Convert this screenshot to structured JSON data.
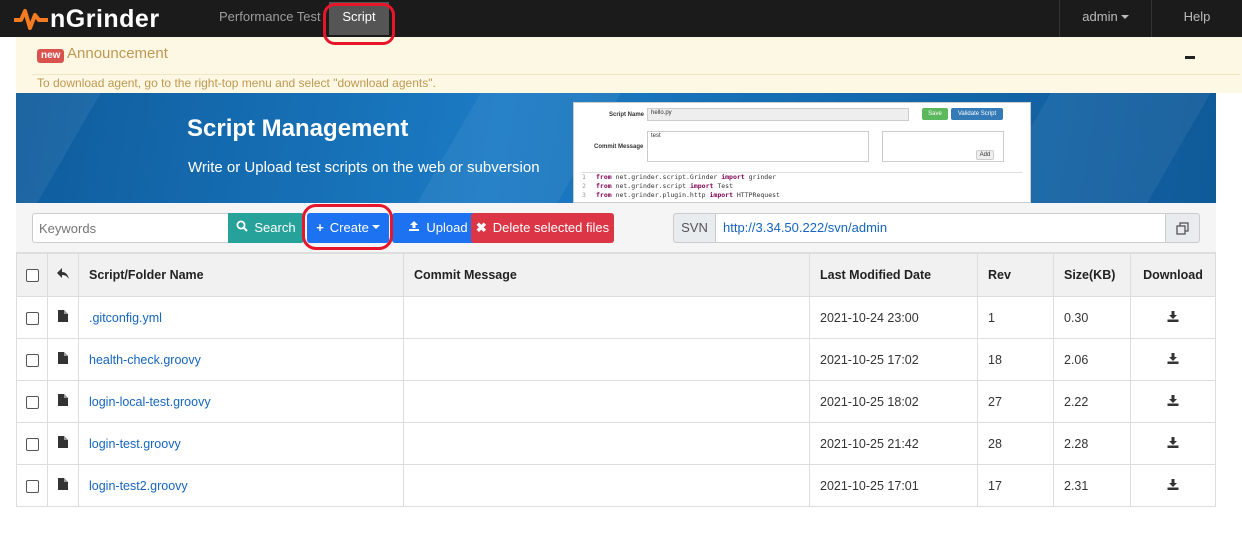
{
  "navbar": {
    "brand": "nGrinder",
    "items": [
      {
        "label": "Performance Test"
      },
      {
        "label": "Script",
        "active": true
      }
    ],
    "user": "admin",
    "help": "Help"
  },
  "announcement": {
    "badge": "new",
    "title": "Announcement",
    "text": "To download agent, go to the right-top menu and select \"download agents\"."
  },
  "banner": {
    "title": "Script Management",
    "subtitle": "Write or Upload test scripts on the web or subversion",
    "preview": {
      "script_name_label": "Script Name",
      "script_name_value": "hello.py",
      "save": "Save",
      "validate": "Validate Script",
      "commit_label": "Commit Message",
      "commit_value": "test",
      "add": "Add",
      "code": [
        {
          "ln": "1",
          "kw1": "from",
          "mod": " net.grinder.script.Grinder ",
          "kw2": "import",
          "name": " grinder"
        },
        {
          "ln": "2",
          "kw1": "from",
          "mod": " net.grinder.script ",
          "kw2": "import",
          "name": " Test"
        },
        {
          "ln": "3",
          "kw1": "from",
          "mod": " net.grinder.plugin.http ",
          "kw2": "import",
          "name": " HTTPRequest"
        }
      ]
    }
  },
  "toolbar": {
    "search_placeholder": "Keywords",
    "search": "Search",
    "create": "Create",
    "upload": "Upload",
    "delete": "Delete selected files",
    "svn_label": "SVN",
    "svn_url": "http://3.34.50.222/svn/admin"
  },
  "table": {
    "headers": {
      "name": "Script/Folder Name",
      "message": "Commit Message",
      "date": "Last Modified Date",
      "rev": "Rev",
      "size": "Size(KB)",
      "download": "Download"
    },
    "rows": [
      {
        "name": ".gitconfig.yml",
        "message": "",
        "date": "2021-10-24 23:00",
        "rev": "1",
        "size": "0.30"
      },
      {
        "name": "health-check.groovy",
        "message": "",
        "date": "2021-10-25 17:02",
        "rev": "18",
        "size": "2.06"
      },
      {
        "name": "login-local-test.groovy",
        "message": "",
        "date": "2021-10-25 18:02",
        "rev": "27",
        "size": "2.22"
      },
      {
        "name": "login-test.groovy",
        "message": "",
        "date": "2021-10-25 21:42",
        "rev": "28",
        "size": "2.28"
      },
      {
        "name": "login-test2.groovy",
        "message": "",
        "date": "2021-10-25 17:01",
        "rev": "17",
        "size": "2.31"
      }
    ]
  },
  "colors": {
    "navbar": "#1b1b1b",
    "primary": "#1d72f2",
    "search": "#26a29a",
    "danger": "#dc3545",
    "annotation": "#e8162b"
  }
}
